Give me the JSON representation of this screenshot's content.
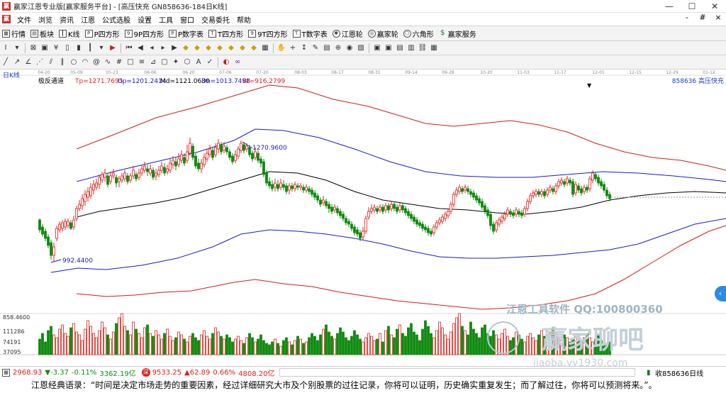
{
  "window": {
    "title": "赢家江恩专业版[赢家服务平台] - [高压快充 GN858636-184日K线]",
    "controls": [
      "—",
      "☐",
      "✕"
    ]
  },
  "menu": {
    "items": [
      "文件",
      "浏览",
      "资讯",
      "江恩",
      "公式选股",
      "设置",
      "工具",
      "窗口",
      "交易委托",
      "帮助"
    ],
    "right": [
      "-",
      "#",
      "×"
    ]
  },
  "toolbar": {
    "items": [
      {
        "label": "行情",
        "icon": "grid-icon"
      },
      {
        "label": "板块",
        "icon": "blocks-icon"
      },
      {
        "label": "K线",
        "icon": "candles-icon"
      },
      {
        "label": "P四方形",
        "icon": "p-square-icon"
      },
      {
        "label": "9P四方形",
        "icon": "9p-square-icon"
      },
      {
        "label": "P数字表",
        "icon": "p-table-icon"
      },
      {
        "label": "T四方形",
        "icon": "t-square-icon"
      },
      {
        "label": "9T四方形",
        "icon": "9t-square-icon"
      },
      {
        "label": "T数字表",
        "icon": "t-table-icon"
      },
      {
        "label": "江恩轮",
        "icon": "gann-wheel-icon"
      },
      {
        "label": "赢家轮",
        "icon": "winner-wheel-icon"
      },
      {
        "label": "六角形",
        "icon": "hexagon-icon"
      },
      {
        "label": "赢家服务",
        "icon": "service-icon"
      }
    ]
  },
  "chart": {
    "period_label": "日K线",
    "indicator_name": "极反通道",
    "params": [
      {
        "text": "Tp=1271.7695",
        "color": "#e0201a"
      },
      {
        "text": "Up=1201.2414",
        "color": "#1a1ad0"
      },
      {
        "text": "Md=1121.0630",
        "color": "#000000"
      },
      {
        "text": "Dn=1013.7498",
        "color": "#1a1ad0"
      },
      {
        "text": "Bt=916.2799",
        "color": "#e0201a"
      }
    ],
    "stock_code_name": "858636 高压快充",
    "dates": [
      "04-20",
      "05-09",
      "05-23",
      "06-06",
      "06-20",
      "07-06",
      "07-20",
      "08-03",
      "08-17",
      "08-31",
      "09-14",
      "09-28",
      "10-20",
      "11-03",
      "11-17",
      "12-01",
      "12-15",
      "12-29",
      "01-12"
    ],
    "high_label": "1270.9600",
    "low_label": "992.4400",
    "volume_axis": [
      "858.4600",
      "111286",
      "74191",
      "37095"
    ],
    "watermark_1": "江恩工具软件  QQ:100800360",
    "watermark_2": "赢家聊吧",
    "watermark_3": "jiaoba.yy1930.com",
    "colors": {
      "up": "#e0201a",
      "down": "#0f8a0f",
      "upper_band": "#1a1ad0",
      "outer_band": "#d21c1c",
      "mid_line": "#000000"
    }
  },
  "status": {
    "index1_value": "2968.93",
    "index1_change": "▼-3.37",
    "index1_pct": "-0.11%",
    "index1_amount": "3362.19亿",
    "index2_value": "9533.25",
    "index2_change": "▲62.89",
    "index2_pct": "0.66%",
    "index2_amount": "4808.20亿",
    "right_label": "收858636日线"
  },
  "quote": {
    "text": "江恩经典语录：“时间是决定市场走势的重要因素，经过详细研究大市及个别股票的过往记录，你将可以证明，历史确实重复发生；而了解过往，你将可以预测将来。”。"
  }
}
